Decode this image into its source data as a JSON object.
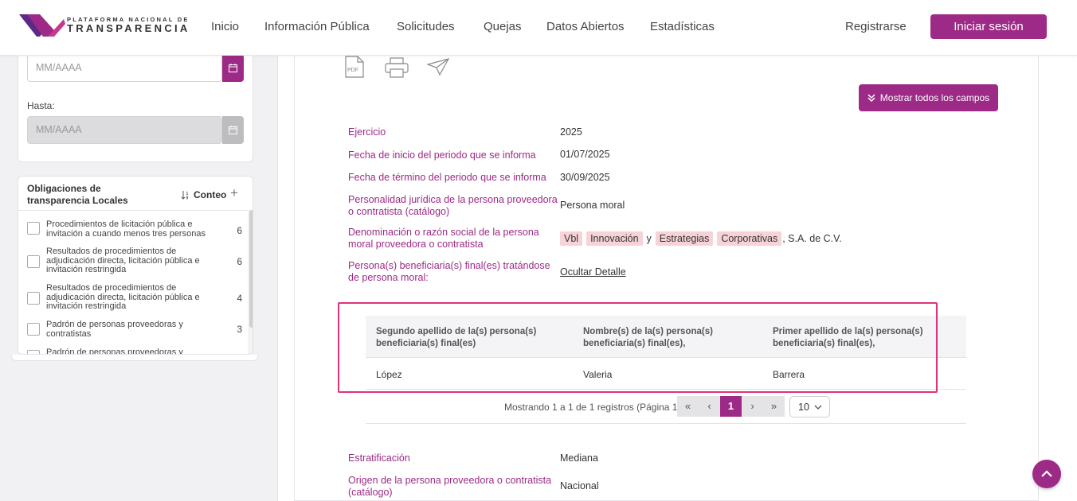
{
  "brand": {
    "top_text": "PLATAFORMA NACIONAL DE",
    "main_text": "TRANSPARENCIA",
    "color": "#9d2a86"
  },
  "nav": {
    "items": [
      "Inicio",
      "Información Pública",
      "Solicitudes",
      "Quejas",
      "Datos Abiertos",
      "Estadísticas"
    ],
    "register": "Registrarse",
    "login": "Iniciar sesión"
  },
  "sidebar": {
    "desde_placeholder": "MM/AAAA",
    "hasta_label": "Hasta:",
    "hasta_placeholder": "MM/AAAA",
    "obligaciones_title": "Obligaciones de transparencia Locales",
    "sort_label": "Conteo",
    "items": [
      {
        "label": "Procedimientos de licitación pública e invitación a cuando menos tres personas",
        "count": "6"
      },
      {
        "label": "Resultados de procedimientos de adjudicación directa, licitación pública e invitación restringida",
        "count": "6"
      },
      {
        "label": "Resultados de procedimientos de adjudicación directa, licitación pública e invitación restringida",
        "count": "4"
      },
      {
        "label": "Padrón de personas proveedoras y contratistas",
        "count": "3"
      },
      {
        "label": "Padrón de personas proveedoras y",
        "count": ""
      }
    ]
  },
  "toolbar": {
    "pdf_icon": "pdf-icon",
    "print_icon": "printer-icon",
    "send_icon": "paper-plane-icon",
    "pdf_label": "PDF"
  },
  "main": {
    "show_all_button": "Mostrar todos los campos",
    "fields": [
      {
        "label": "Ejercicio",
        "value": "2025"
      },
      {
        "label": "Fecha de inicio del periodo que se informa",
        "value": "01/07/2025"
      },
      {
        "label": "Fecha de término del periodo que se informa",
        "value": "30/09/2025"
      },
      {
        "label": "Personalidad jurídica de la persona proveedora o contratista (catálogo)",
        "value": "Persona moral"
      },
      {
        "label": "Denominación o razón social de la persona moral proveedora o contratista",
        "value": ""
      },
      {
        "label": "Persona(s) beneficiaria(s) final(es) tratándose de persona moral:",
        "value": ""
      }
    ],
    "denominacion_tags": [
      "Vbl",
      "Innovación",
      "Estrategias",
      "Corporativas"
    ],
    "denominacion_y": "y",
    "denominacion_suffix": ", S.A. de C.V.",
    "detail_link": "Ocultar Detalle",
    "table": {
      "headers": [
        "Segundo apellido de la(s) persona(s) beneficiaria(s) final(es)",
        "Nombre(s) de la(s) persona(s) beneficiaria(s) final(es),",
        "Primer apellido de la(s) persona(s) beneficiaria(s) final(es),"
      ],
      "rows": [
        [
          "López",
          "Valeria",
          "Barrera"
        ]
      ]
    },
    "pagination": {
      "info": "Mostrando 1 a 1 de 1 registros (Página 1)",
      "first": "«",
      "prev": "‹",
      "current": "1",
      "next": "›",
      "last": "»",
      "page_size": "10"
    },
    "fields_after": [
      {
        "label": "Estratificación",
        "value": "Mediana"
      },
      {
        "label": "Origen de la persona proveedora o contratista (catálogo)",
        "value": "Nacional"
      }
    ]
  }
}
